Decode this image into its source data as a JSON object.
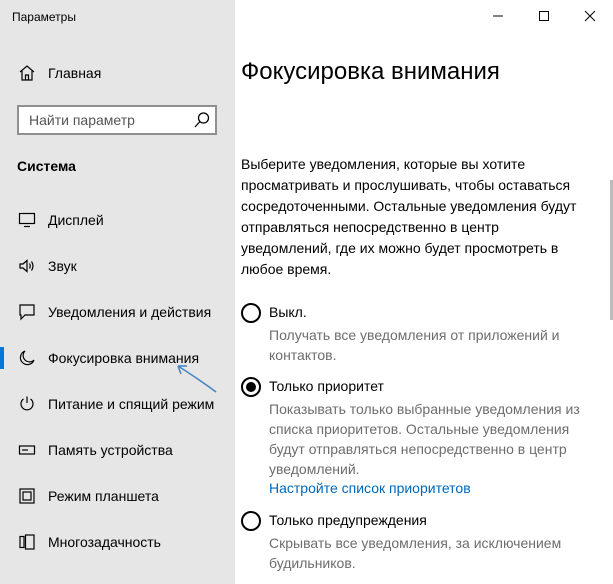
{
  "window": {
    "title": "Параметры"
  },
  "titlebar": {
    "minimize_icon": "minimize-icon",
    "maximize_icon": "maximize-icon",
    "close_icon": "close-icon"
  },
  "sidebar": {
    "home": {
      "label": "Главная",
      "icon": "home-icon"
    },
    "search": {
      "placeholder": "Найти параметр",
      "icon": "search-icon"
    },
    "section_title": "Система",
    "items": [
      {
        "label": "Дисплей",
        "icon": "display-icon",
        "active": false
      },
      {
        "label": "Звук",
        "icon": "sound-icon",
        "active": false
      },
      {
        "label": "Уведомления и действия",
        "icon": "notifications-icon",
        "active": false
      },
      {
        "label": "Фокусировка внимания",
        "icon": "moon-icon",
        "active": true
      },
      {
        "label": "Питание и спящий режим",
        "icon": "power-icon",
        "active": false
      },
      {
        "label": "Память устройства",
        "icon": "storage-icon",
        "active": false
      },
      {
        "label": "Режим планшета",
        "icon": "tablet-icon",
        "active": false
      },
      {
        "label": "Многозадачность",
        "icon": "multitasking-icon",
        "active": false
      }
    ],
    "accent_color": "#0078d7"
  },
  "main": {
    "title": "Фокусировка внимания",
    "intro": "Выберите уведомления, которые вы хотите просматривать и прослушивать, чтобы оставаться сосредоточенными. Остальные уведомления будут отправляться непосредственно в центр уведомлений, где их можно будет просмотреть в любое время.",
    "options": [
      {
        "label": "Выкл.",
        "description": "Получать все уведомления от приложений и контактов.",
        "checked": false
      },
      {
        "label": "Только приоритет",
        "description": "Показывать только выбранные уведомления из списка приоритетов. Остальные уведомления будут отправляться непосредственно в центр уведомлений.",
        "link": "Настройте список приоритетов",
        "checked": true
      },
      {
        "label": "Только предупреждения",
        "description": "Скрывать все уведомления, за исключением будильников.",
        "checked": false
      }
    ],
    "link_color": "#0067b8"
  }
}
